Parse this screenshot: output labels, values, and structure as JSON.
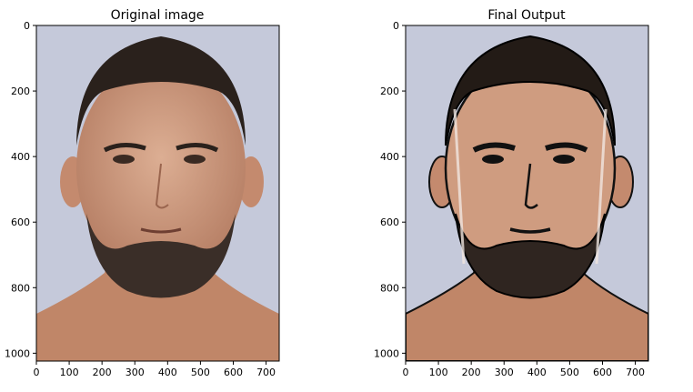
{
  "chart_data": [
    {
      "type": "image",
      "title": "Original image",
      "xlim": [
        0,
        740
      ],
      "ylim": [
        1024,
        0
      ],
      "xticks": [
        0,
        100,
        200,
        300,
        400,
        500,
        600,
        700
      ],
      "yticks": [
        0,
        200,
        400,
        600,
        800,
        1000
      ],
      "image_content": "portrait photograph of a bearded man on a light blue-grey background"
    },
    {
      "type": "image",
      "title": "Final Output",
      "xlim": [
        0,
        740
      ],
      "ylim": [
        1024,
        0
      ],
      "xticks": [
        0,
        100,
        200,
        300,
        400,
        500,
        600,
        700
      ],
      "yticks": [
        0,
        200,
        400,
        600,
        800,
        1000
      ],
      "image_content": "cartoonized version of the same portrait with dark edge outlines"
    }
  ],
  "colors": {
    "background": "#c5c9da",
    "skin": "#c89276",
    "skin_light": "#dcae93",
    "hair": "#2a211c",
    "beard": "#3a2e28",
    "outline": "#111111"
  }
}
